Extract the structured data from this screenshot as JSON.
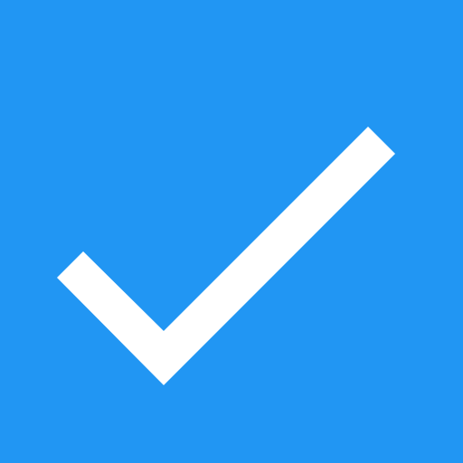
{
  "icon": {
    "name": "check-icon",
    "background_color": "#2196F3",
    "glyph_color": "#FFFFFF"
  }
}
